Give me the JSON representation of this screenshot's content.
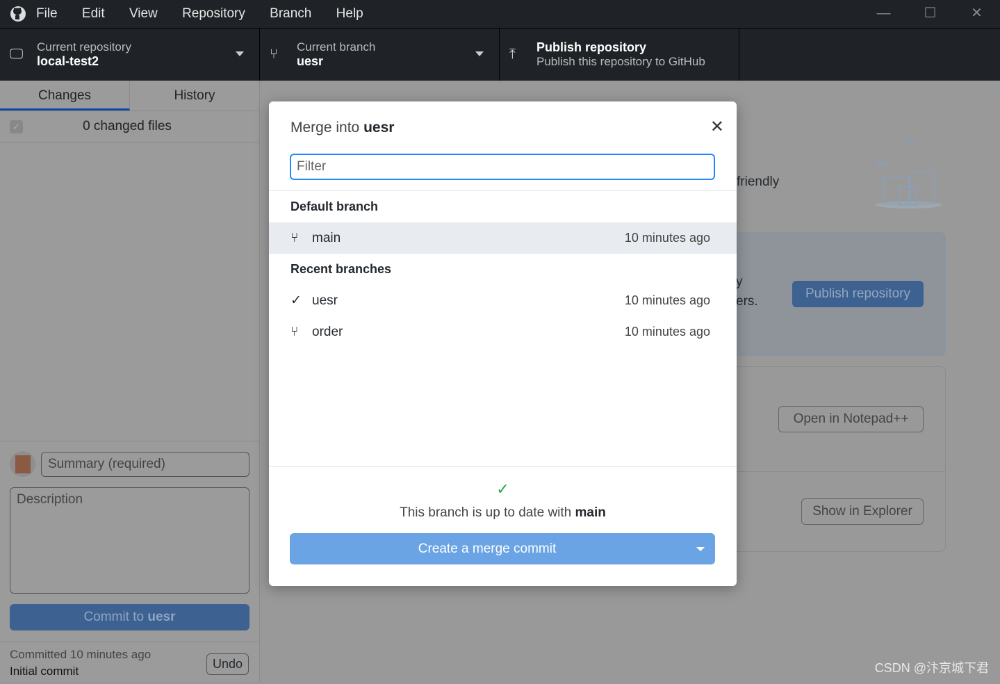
{
  "window": {
    "menu": [
      "File",
      "Edit",
      "View",
      "Repository",
      "Branch",
      "Help"
    ],
    "controls": [
      "—",
      "☐",
      "✕"
    ]
  },
  "toolbar": {
    "repo": {
      "label": "Current repository",
      "value": "local-test2"
    },
    "branch": {
      "label": "Current branch",
      "value": "uesr"
    },
    "publish": {
      "title": "Publish repository",
      "subtitle": "Publish this repository to GitHub"
    }
  },
  "sidebar": {
    "tabs": [
      "Changes",
      "History"
    ],
    "changed_files": "0 changed files",
    "summary_placeholder": "Summary (required)",
    "description_placeholder": "Description",
    "commit_prefix": "Commit to ",
    "commit_branch": "uesr",
    "last_commit": "Committed 10 minutes ago",
    "last_commit_msg": "Initial commit",
    "undo": "Undo"
  },
  "main": {
    "partial1": "friendly",
    "partial2": "y",
    "partial3": "ers.",
    "publish_button": "Publish repository",
    "open_editor": "Open in Notepad++",
    "show_explorer": "Show in Explorer",
    "watermark": "CSDN @汴京城下君"
  },
  "modal": {
    "title_prefix": "Merge into ",
    "title_branch": "uesr",
    "filter_placeholder": "Filter",
    "default_header": "Default branch",
    "default_branches": [
      {
        "name": "main",
        "time": "10 minutes ago",
        "icon": "branch-icon"
      }
    ],
    "recent_header": "Recent branches",
    "recent_branches": [
      {
        "name": "uesr",
        "time": "10 minutes ago",
        "icon": "check-icon"
      },
      {
        "name": "order",
        "time": "10 minutes ago",
        "icon": "branch-icon"
      }
    ],
    "status_prefix": "This branch is up to date with ",
    "status_branch": "main",
    "merge_button": "Create a merge commit"
  },
  "colors": {
    "accent": "#2188ff",
    "merge_button": "#6aa4e4",
    "check": "#28a745"
  }
}
